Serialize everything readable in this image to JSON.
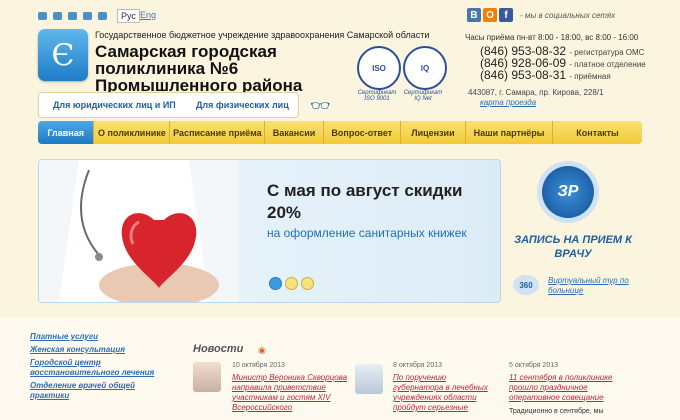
{
  "lang": {
    "ru": "Рус",
    "en": "Eng"
  },
  "org": "Государственное бюджетное учреждение здравоохранения Самарской области",
  "title_line1": "Самарская городская поликлиника №6",
  "title_line2": "Промышленного района",
  "audience": {
    "legal": "Для юридических лиц и ИП",
    "individuals": "Для физических лиц"
  },
  "certs": [
    {
      "label": "Сертификат ISO 9001"
    },
    {
      "label": "Сертификат IQ Net"
    }
  ],
  "social": {
    "text": "- мы в социальных сетях",
    "vk": "В",
    "ok": "О",
    "fb": "f"
  },
  "hours": "Часы приёма пн-вт 8:00 - 18:00, вс 8:00 - 16:00",
  "phones": [
    {
      "number": "(846) 953-08-32",
      "label": "- регистратура ОМС"
    },
    {
      "number": "(846) 928-06-09",
      "label": "- платное отделение"
    },
    {
      "number": "(846) 953-08-31",
      "label": "- приёмная"
    }
  ],
  "address": "443087, г. Самара, пр. Кирова, 228/1",
  "map_link": "карта проезда",
  "nav": [
    "Главная",
    "О поликлинике",
    "Расписание приёма",
    "Вакансии",
    "Вопрос-ответ",
    "Лицензии",
    "Наши партнёры",
    "Контакты"
  ],
  "banner": {
    "h1": "С мая по август скидки 20%",
    "sub": "на оформление санитарных книжек"
  },
  "zapis": "ЗАПИСЬ НА ПРИЕМ К ВРАЧУ",
  "badge_text": "ЗР",
  "tour": "Виртуальный тур по больнице",
  "tour_badge": "360",
  "sidebar": [
    "Платные услуги",
    "Женская консультация",
    "Городской центр восстановительного лечения",
    "Отделение врачей общей практики"
  ],
  "news_heading": "Новости",
  "news": [
    {
      "date": "10 октября 2013",
      "title": "Министр Вероника Скворцова направила приветствие участникам и гостям XIV Всероссийского"
    },
    {
      "date": "8 октября 2013",
      "title": "По поручению губернатора в лечебных учреждениях области пройдут серьезные"
    },
    {
      "date": "5 октября 2013",
      "title": "11 сентября в поликлинике прошло праздничное оперативное совещание",
      "text": "Традиционно в сентябре, мы"
    }
  ],
  "colors": {
    "nav_yellow": "#f2c937",
    "nav_active": "#1d78c6",
    "link_red": "#c0253c",
    "link_blue": "#2c6db3"
  }
}
